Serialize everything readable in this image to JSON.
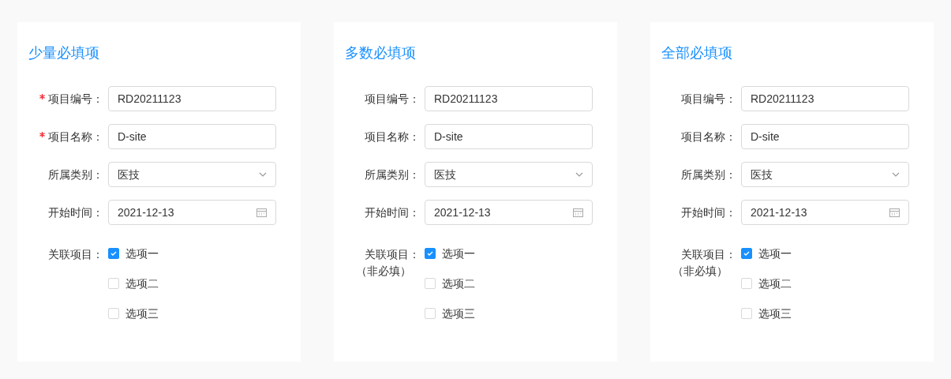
{
  "cards": [
    {
      "title": "少量必填项",
      "fields": [
        {
          "kind": "text",
          "label": "项目编号：",
          "required": true,
          "value": "RD20211123"
        },
        {
          "kind": "text",
          "label": "项目名称：",
          "required": true,
          "value": "D-site"
        },
        {
          "kind": "select",
          "label": "所属类别：",
          "required": false,
          "value": "医技"
        },
        {
          "kind": "date",
          "label": "开始时间：",
          "required": false,
          "value": "2021-12-13"
        },
        {
          "kind": "checkboxes",
          "label": "关联项目：",
          "required": false,
          "options": [
            {
              "label": "选项一",
              "checked": true
            },
            {
              "label": "选项二",
              "checked": false
            },
            {
              "label": "选项三",
              "checked": false
            }
          ]
        }
      ]
    },
    {
      "title": "多数必填项",
      "fields": [
        {
          "kind": "text",
          "label": "项目编号：",
          "required": false,
          "value": "RD20211123"
        },
        {
          "kind": "text",
          "label": "项目名称：",
          "required": false,
          "value": "D-site"
        },
        {
          "kind": "select",
          "label": "所属类别：",
          "required": false,
          "value": "医技"
        },
        {
          "kind": "date",
          "label": "开始时间：",
          "required": false,
          "value": "2021-12-13"
        },
        {
          "kind": "checkboxes",
          "label": "关联项目：",
          "note": "（非必填）",
          "required": false,
          "options": [
            {
              "label": "选项一",
              "checked": true
            },
            {
              "label": "选项二",
              "checked": false
            },
            {
              "label": "选项三",
              "checked": false
            }
          ]
        }
      ]
    },
    {
      "title": "全部必填项",
      "fields": [
        {
          "kind": "text",
          "label": "项目编号：",
          "required": false,
          "value": "RD20211123"
        },
        {
          "kind": "text",
          "label": "项目名称：",
          "required": false,
          "value": "D-site"
        },
        {
          "kind": "select",
          "label": "所属类别：",
          "required": false,
          "value": "医技"
        },
        {
          "kind": "date",
          "label": "开始时间：",
          "required": false,
          "value": "2021-12-13"
        },
        {
          "kind": "checkboxes",
          "label": "关联项目：",
          "note": "（非必填）",
          "required": false,
          "options": [
            {
              "label": "选项一",
              "checked": true
            },
            {
              "label": "选项二",
              "checked": false
            },
            {
              "label": "选项三",
              "checked": false
            }
          ]
        }
      ]
    }
  ]
}
